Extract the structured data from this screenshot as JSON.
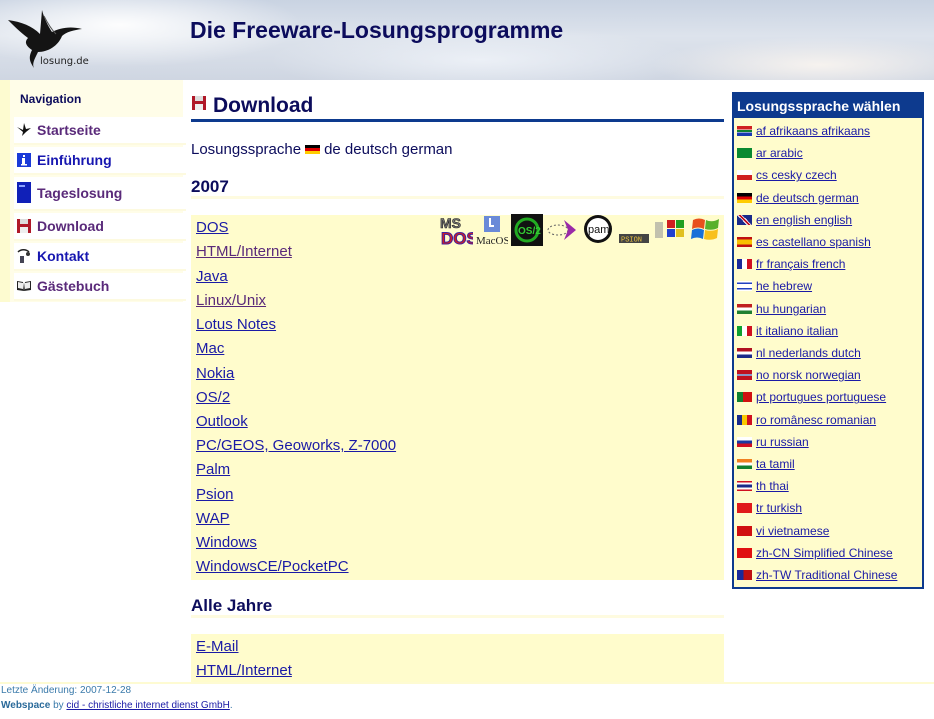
{
  "header": {
    "logo_text": "losung.de",
    "site_title": "Die Freeware-Losungsprogramme"
  },
  "nav": {
    "heading": "Navigation",
    "items": [
      {
        "label": "Startseite",
        "icon": "bird-icon",
        "visited": true
      },
      {
        "label": "Einführung",
        "icon": "info-icon",
        "visited": false
      },
      {
        "label": "Tageslosung",
        "icon": "book-blue-icon",
        "visited": true
      },
      {
        "label": "Download",
        "icon": "floppy-disk-icon",
        "visited": true
      },
      {
        "label": "Kontakt",
        "icon": "contact-icon",
        "visited": false
      },
      {
        "label": "Gästebuch",
        "icon": "open-book-icon",
        "visited": true
      }
    ]
  },
  "main": {
    "heading": "Download",
    "language_label": "Losungssprache",
    "language_value": "de deutsch german",
    "sections": [
      {
        "title": "2007",
        "links": [
          {
            "label": "DOS",
            "visited": false
          },
          {
            "label": "HTML/Internet",
            "visited": true
          },
          {
            "label": "Java",
            "visited": false
          },
          {
            "label": "Linux/Unix",
            "visited": true
          },
          {
            "label": "Lotus Notes",
            "visited": false
          },
          {
            "label": "Mac",
            "visited": false
          },
          {
            "label": "Nokia",
            "visited": false
          },
          {
            "label": "OS/2",
            "visited": false
          },
          {
            "label": "Outlook",
            "visited": false
          },
          {
            "label": "PC/GEOS, Geoworks, Z-7000",
            "visited": false
          },
          {
            "label": "Palm",
            "visited": false
          },
          {
            "label": "Psion",
            "visited": false
          },
          {
            "label": "WAP",
            "visited": false
          },
          {
            "label": "Windows",
            "visited": false
          },
          {
            "label": "WindowsCE/PocketPC",
            "visited": false
          }
        ]
      },
      {
        "title": "Alle Jahre",
        "links": [
          {
            "label": "E-Mail",
            "visited": false
          },
          {
            "label": "HTML/Internet",
            "visited": false
          }
        ]
      }
    ],
    "os_logos": [
      "ms-dos-logo",
      "macos-logo",
      "os2-logo",
      "symbian-logo",
      "palm-logo",
      "psion-logo",
      "windows-logo",
      "windows-xp-logo"
    ]
  },
  "language_panel": {
    "title": "Losungssprache wählen",
    "languages": [
      {
        "label": "af afrikaans afrikaans",
        "flag": "za"
      },
      {
        "label": "ar arabic",
        "flag": "sa"
      },
      {
        "label": "cs cesky czech",
        "flag": "cz"
      },
      {
        "label": "de deutsch german",
        "flag": "de"
      },
      {
        "label": "en english english",
        "flag": "gb"
      },
      {
        "label": "es castellano spanish",
        "flag": "es"
      },
      {
        "label": "fr français french",
        "flag": "fr"
      },
      {
        "label": "he hebrew",
        "flag": "il"
      },
      {
        "label": "hu hungarian",
        "flag": "hu"
      },
      {
        "label": "it italiano italian",
        "flag": "it"
      },
      {
        "label": "nl nederlands dutch",
        "flag": "nl"
      },
      {
        "label": "no norsk norwegian",
        "flag": "no"
      },
      {
        "label": "pt portugues portuguese",
        "flag": "pt"
      },
      {
        "label": "ro românesc romanian",
        "flag": "ro"
      },
      {
        "label": "ru russian",
        "flag": "ru"
      },
      {
        "label": "ta tamil",
        "flag": "in"
      },
      {
        "label": "th thai",
        "flag": "th"
      },
      {
        "label": "tr turkish",
        "flag": "tr"
      },
      {
        "label": "vi vietnamese",
        "flag": "vn"
      },
      {
        "label": "zh-CN Simplified Chinese",
        "flag": "cn"
      },
      {
        "label": "zh-TW Traditional Chinese",
        "flag": "tw"
      }
    ]
  },
  "footer": {
    "last_changed": "Letzte Änderung: 2007-12-28",
    "host_prefix": "Webspace",
    "host_by": "by",
    "host_link": "cid - christliche internet dienst GmbH",
    "host_suffix": "."
  },
  "colors": {
    "brand_navy": "#0d3a8e",
    "heading_text": "#0c0c5c",
    "link": "#1a1aa6",
    "link_visited": "#5a2a7a",
    "box_bg": "#fffccc"
  }
}
